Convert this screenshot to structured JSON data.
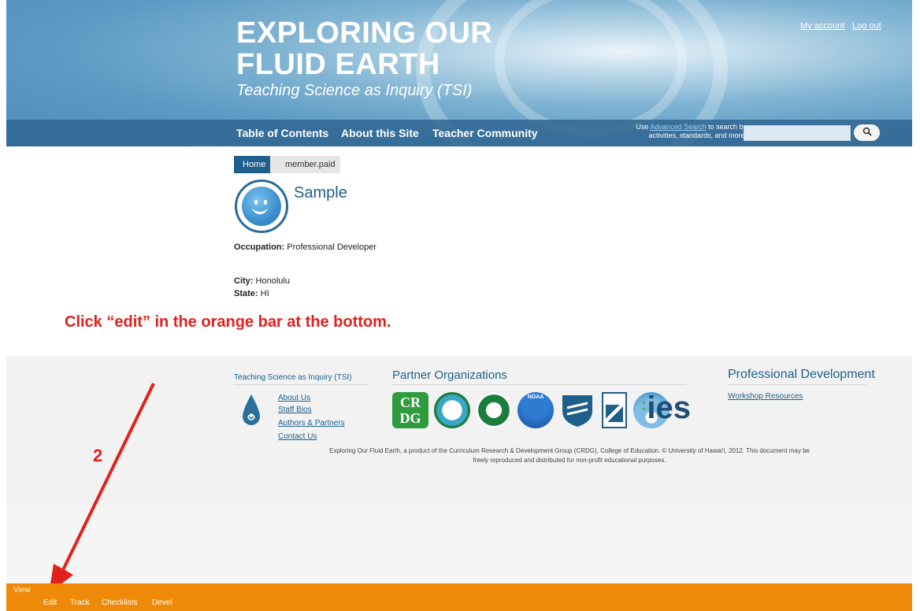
{
  "header": {
    "title_line1": "EXPLORING OUR",
    "title_line2": "FLUID EARTH",
    "subtitle": "Teaching Science as Inquiry (TSI)",
    "my_account": "My account",
    "log_out": "Log out"
  },
  "nav": {
    "items": [
      "Table of Contents",
      "About this Site",
      "Teacher Community"
    ],
    "search_note_pre": "Use ",
    "search_note_link": "Advanced Search",
    "search_note_post": " to search by activities, standards, and more.",
    "search_value": "",
    "search_icon": "magnifier-icon"
  },
  "breadcrumb": {
    "home": "Home",
    "current": "member.paid"
  },
  "profile": {
    "name": "Sample",
    "occupation_label": "Occupation:",
    "occupation_value": "Professional Developer",
    "city_label": "City:",
    "city_value": "Honolulu",
    "state_label": "State:",
    "state_value": "HI"
  },
  "annotation": {
    "instruction": "Click “edit” in the orange bar at the bottom.",
    "step_number": "2",
    "color": "#e0211c"
  },
  "footer": {
    "tsi_heading": "Teaching Science as Inquiry (TSI)",
    "links": [
      "About Us",
      "Staff Bios",
      "Authors & Partners",
      "Contact Us"
    ],
    "partners_heading": "Partner Organizations",
    "pd_heading": "Professional Development",
    "pd_links": [
      "Workshop Resources"
    ],
    "ies_text": "ies",
    "crdg_text1": "CR",
    "crdg_text2": "DG",
    "noaa_text": "NOAA",
    "copyright": "Exploring Our Fluid Earth, a product of the Curriculum Research & Development Group (CRDG), College of Education. © University of Hawaiʻi, 2012. This document may be freely reproduced and distributed for non-profit educational purposes."
  },
  "admin_bar": {
    "view": "View",
    "items": [
      "Edit",
      "Track",
      "Checklists",
      "Devel"
    ],
    "color": "#ee8a07"
  }
}
